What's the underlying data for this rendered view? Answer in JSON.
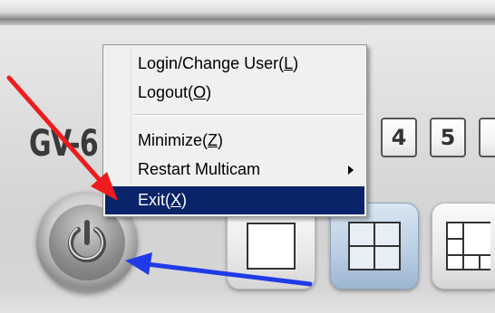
{
  "model": {
    "label": "GV-6"
  },
  "camera_buttons": [
    "4",
    "5"
  ],
  "menu": {
    "items": [
      {
        "label": "Login/Change User(",
        "key": "L",
        "tail": ")"
      },
      {
        "label": "Logout(",
        "key": "O",
        "tail": ")"
      },
      {
        "label": "Minimize(",
        "key": "Z",
        "tail": ")"
      },
      {
        "label": "Restart Multicam",
        "key": "",
        "tail": "",
        "has_submenu": true
      },
      {
        "label": "Exit(",
        "key": "X",
        "tail": ")",
        "highlighted": true
      }
    ]
  },
  "layouts": [
    "single-view",
    "quad-view",
    "multi-view"
  ],
  "icons": {
    "power": "power-icon",
    "submenu": "chevron-right-icon",
    "layout_single": "single-layout-icon",
    "layout_quad": "quad-layout-icon",
    "layout_multi": "multi-layout-icon"
  },
  "colors": {
    "menu_highlight": "#0a246a",
    "annotation_red": "#ee1c1c",
    "annotation_blue": "#1f3be8"
  }
}
